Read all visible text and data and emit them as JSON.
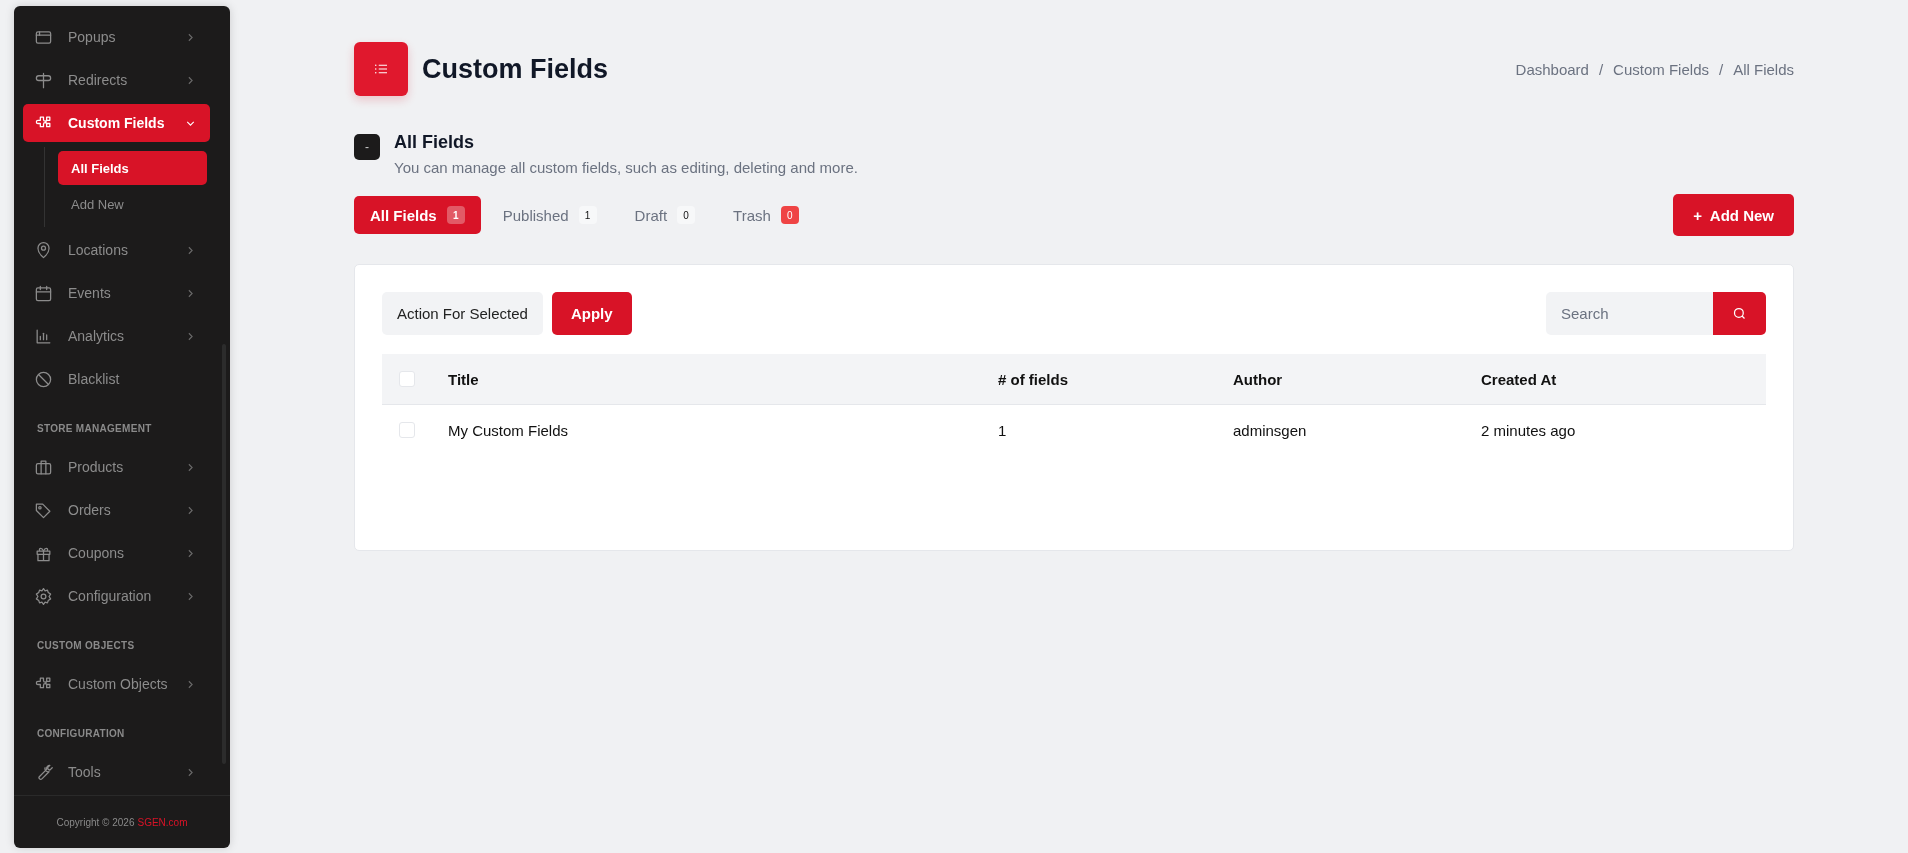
{
  "sidebar": {
    "sections": [
      {
        "items": [
          {
            "label": "Popups",
            "kind": "submenu",
            "expanded": false,
            "selected": false
          },
          {
            "label": "Redirects",
            "kind": "submenu",
            "expanded": false,
            "selected": false
          },
          {
            "label": "Custom Fields",
            "kind": "submenu",
            "expanded": true,
            "selected": true,
            "children": [
              {
                "label": "All Fields",
                "selected": true
              },
              {
                "label": "Add New",
                "selected": false
              }
            ]
          },
          {
            "label": "Locations",
            "kind": "submenu",
            "expanded": false,
            "selected": false
          },
          {
            "label": "Events",
            "kind": "submenu",
            "expanded": false,
            "selected": false
          },
          {
            "label": "Analytics",
            "kind": "submenu",
            "expanded": false,
            "selected": false
          },
          {
            "label": "Blacklist",
            "kind": "link",
            "selected": false
          }
        ]
      },
      {
        "heading": "STORE MANAGEMENT",
        "items": [
          {
            "label": "Products",
            "kind": "submenu",
            "expanded": false,
            "selected": false
          },
          {
            "label": "Orders",
            "kind": "submenu",
            "expanded": false,
            "selected": false
          },
          {
            "label": "Coupons",
            "kind": "submenu",
            "expanded": false,
            "selected": false
          },
          {
            "label": "Configuration",
            "kind": "submenu",
            "expanded": false,
            "selected": false
          }
        ]
      },
      {
        "heading": "CUSTOM OBJECTS",
        "items": [
          {
            "label": "Custom Objects",
            "kind": "submenu",
            "expanded": false,
            "selected": false
          }
        ]
      },
      {
        "heading": "CONFIGURATION",
        "items": [
          {
            "label": "Tools",
            "kind": "submenu",
            "expanded": false,
            "selected": false
          }
        ]
      }
    ],
    "footer": {
      "text": "Copyright © 2026",
      "link": "SGEN.com"
    }
  },
  "page": {
    "title": "Custom Fields",
    "breadcrumb": {
      "separator": "/",
      "items": [
        "Dashboard",
        "Custom Fields",
        "All Fields"
      ]
    },
    "section": {
      "toggle": "-",
      "title": "All Fields",
      "description": "You can manage all custom fields, such as editing, deleting and more."
    },
    "tabs": [
      {
        "label": "All Fields",
        "count": "1",
        "selected": true,
        "kind": "normal"
      },
      {
        "label": "Published",
        "count": "1",
        "selected": false,
        "kind": "normal"
      },
      {
        "label": "Draft",
        "count": "0",
        "selected": false,
        "kind": "normal"
      },
      {
        "label": "Trash",
        "count": "0",
        "selected": false,
        "kind": "alert"
      }
    ],
    "add_button": {
      "icon": "+",
      "label": "Add New"
    }
  },
  "table": {
    "bulk_action": "Action For Selected",
    "apply": "Apply",
    "search": {
      "placeholder": "Search"
    },
    "select_all": {
      "checked": false
    },
    "columns": [
      "Title",
      "# of fields",
      "Author",
      "Created At"
    ],
    "rows": [
      {
        "checked": false,
        "cells": [
          "My Custom Fields",
          "1",
          "adminsgen",
          "2 minutes ago"
        ]
      }
    ]
  }
}
